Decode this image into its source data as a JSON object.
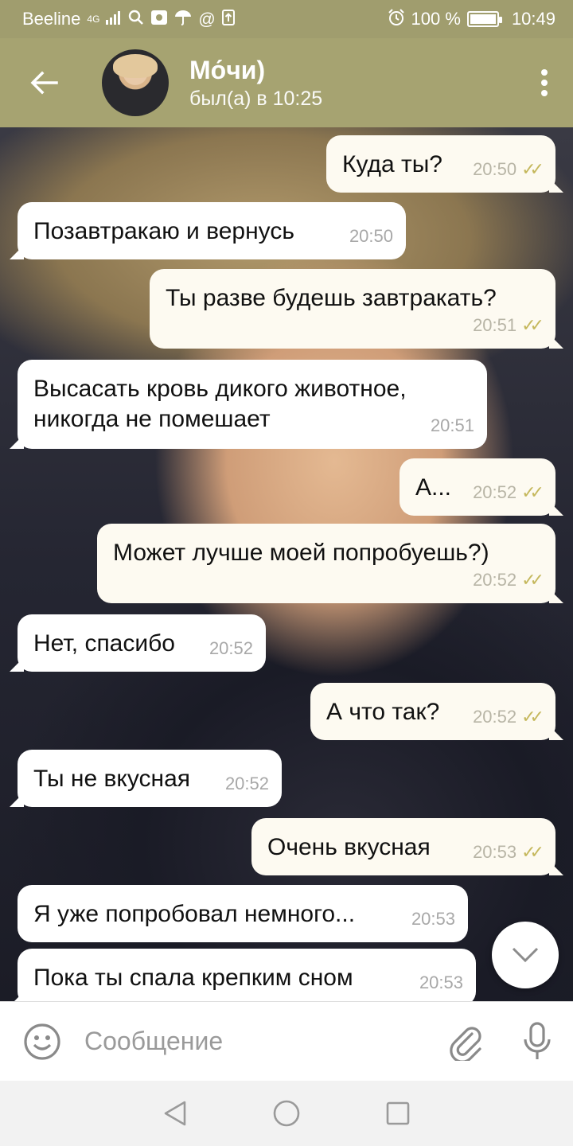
{
  "status_bar": {
    "carrier": "Beeline",
    "network": "4G",
    "battery_percent": "100 %",
    "time": "10:49"
  },
  "header": {
    "contact_name": "Мо́чи)",
    "last_seen": "был(а) в 10:25"
  },
  "messages": [
    {
      "direction": "out",
      "text": "Куда ты?",
      "time": "20:50",
      "read": true
    },
    {
      "direction": "in",
      "text": "Позавтракаю и вернусь",
      "time": "20:50"
    },
    {
      "direction": "out",
      "text": "Ты разве будешь завтракать?",
      "time": "20:51",
      "read": true
    },
    {
      "direction": "in",
      "text_line1": "Высасать кровь дикого животное,",
      "text_line2": "никогда не помешает",
      "time": "20:51"
    },
    {
      "direction": "out",
      "text": "А...",
      "time": "20:52",
      "read": true
    },
    {
      "direction": "out",
      "text": "Может лучше моей попробуешь?)",
      "time": "20:52",
      "read": true
    },
    {
      "direction": "in",
      "text": "Нет, спасибо",
      "time": "20:52"
    },
    {
      "direction": "out",
      "text": "А что так?",
      "time": "20:52",
      "read": true
    },
    {
      "direction": "in",
      "text": "Ты не вкусная",
      "time": "20:52"
    },
    {
      "direction": "out",
      "text": "Очень вкусная",
      "time": "20:53",
      "read": true
    },
    {
      "direction": "in",
      "text": "Я уже попробовал немного...",
      "time": "20:53"
    },
    {
      "direction": "in",
      "text": "Пока ты спала крепким сном",
      "time": "20:53"
    }
  ],
  "input": {
    "placeholder": "Сообщение"
  },
  "icons": {
    "back": "arrow-left-icon",
    "menu": "more-vertical-icon",
    "emoji": "smiley-icon",
    "attach": "paperclip-icon",
    "mic": "microphone-icon",
    "scroll_down": "chevron-down-icon"
  },
  "colors": {
    "header": "#a6a371",
    "status_bar": "#a09d6e",
    "outgoing_bubble": "#fdfaf1",
    "incoming_bubble": "#ffffff",
    "read_checks": "#c5b85d"
  }
}
